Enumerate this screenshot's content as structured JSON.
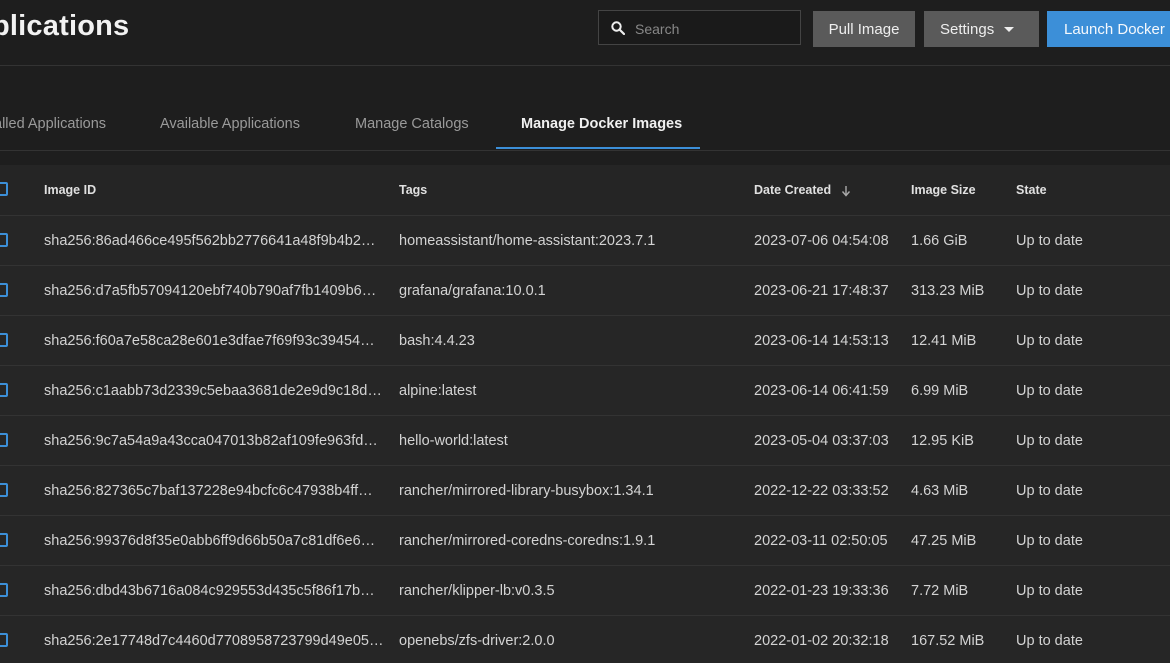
{
  "header": {
    "title": "plications",
    "search_placeholder": "Search",
    "pull_image_label": "Pull Image",
    "settings_label": "Settings",
    "launch_label": "Launch Docker I"
  },
  "tabs": [
    {
      "label": "alled Applications",
      "active": false
    },
    {
      "label": "Available Applications",
      "active": false
    },
    {
      "label": "Manage Catalogs",
      "active": false
    },
    {
      "label": "Manage Docker Images",
      "active": true
    }
  ],
  "table": {
    "columns": {
      "image_id": "Image ID",
      "tags": "Tags",
      "date_created": "Date Created",
      "image_size": "Image Size",
      "state": "State"
    },
    "sort": {
      "column": "date_created",
      "direction": "desc"
    },
    "rows": [
      {
        "image_id": "sha256:86ad466ce495f562bb2776641a48f9b4b2…",
        "tags": "homeassistant/home-assistant:2023.7.1",
        "date": "2023-07-06 04:54:08",
        "size": "1.66 GiB",
        "state": "Up to date"
      },
      {
        "image_id": "sha256:d7a5fb57094120ebf740b790af7fb1409b6…",
        "tags": "grafana/grafana:10.0.1",
        "date": "2023-06-21 17:48:37",
        "size": "313.23 MiB",
        "state": "Up to date"
      },
      {
        "image_id": "sha256:f60a7e58ca28e601e3dfae7f69f93c39454…",
        "tags": "bash:4.4.23",
        "date": "2023-06-14 14:53:13",
        "size": "12.41 MiB",
        "state": "Up to date"
      },
      {
        "image_id": "sha256:c1aabb73d2339c5ebaa3681de2e9d9c18d…",
        "tags": "alpine:latest",
        "date": "2023-06-14 06:41:59",
        "size": "6.99 MiB",
        "state": "Up to date"
      },
      {
        "image_id": "sha256:9c7a54a9a43cca047013b82af109fe963fd…",
        "tags": "hello-world:latest",
        "date": "2023-05-04 03:37:03",
        "size": "12.95 KiB",
        "state": "Up to date"
      },
      {
        "image_id": "sha256:827365c7baf137228e94bcfc6c47938b4ff…",
        "tags": "rancher/mirrored-library-busybox:1.34.1",
        "date": "2022-12-22 03:33:52",
        "size": "4.63 MiB",
        "state": "Up to date"
      },
      {
        "image_id": "sha256:99376d8f35e0abb6ff9d66b50a7c81df6e6…",
        "tags": "rancher/mirrored-coredns-coredns:1.9.1",
        "date": "2022-03-11 02:50:05",
        "size": "47.25 MiB",
        "state": "Up to date"
      },
      {
        "image_id": "sha256:dbd43b6716a084c929553d435c5f86f17b…",
        "tags": "rancher/klipper-lb:v0.3.5",
        "date": "2022-01-23 19:33:36",
        "size": "7.72 MiB",
        "state": "Up to date"
      },
      {
        "image_id": "sha256:2e17748d7c4460d7708958723799d49e05…",
        "tags": "openebs/zfs-driver:2.0.0",
        "date": "2022-01-02 20:32:18",
        "size": "167.52 MiB",
        "state": "Up to date"
      }
    ]
  },
  "colors": {
    "accent": "#3c8fd8",
    "background": "#1e1e1e",
    "row_background": "#262626",
    "secondary_button": "#5a5a5a"
  },
  "icons": {
    "search": "search-icon",
    "settings_caret": "caret-down-icon",
    "sort": "arrow-down-icon",
    "checkbox": "checkbox-icon"
  }
}
